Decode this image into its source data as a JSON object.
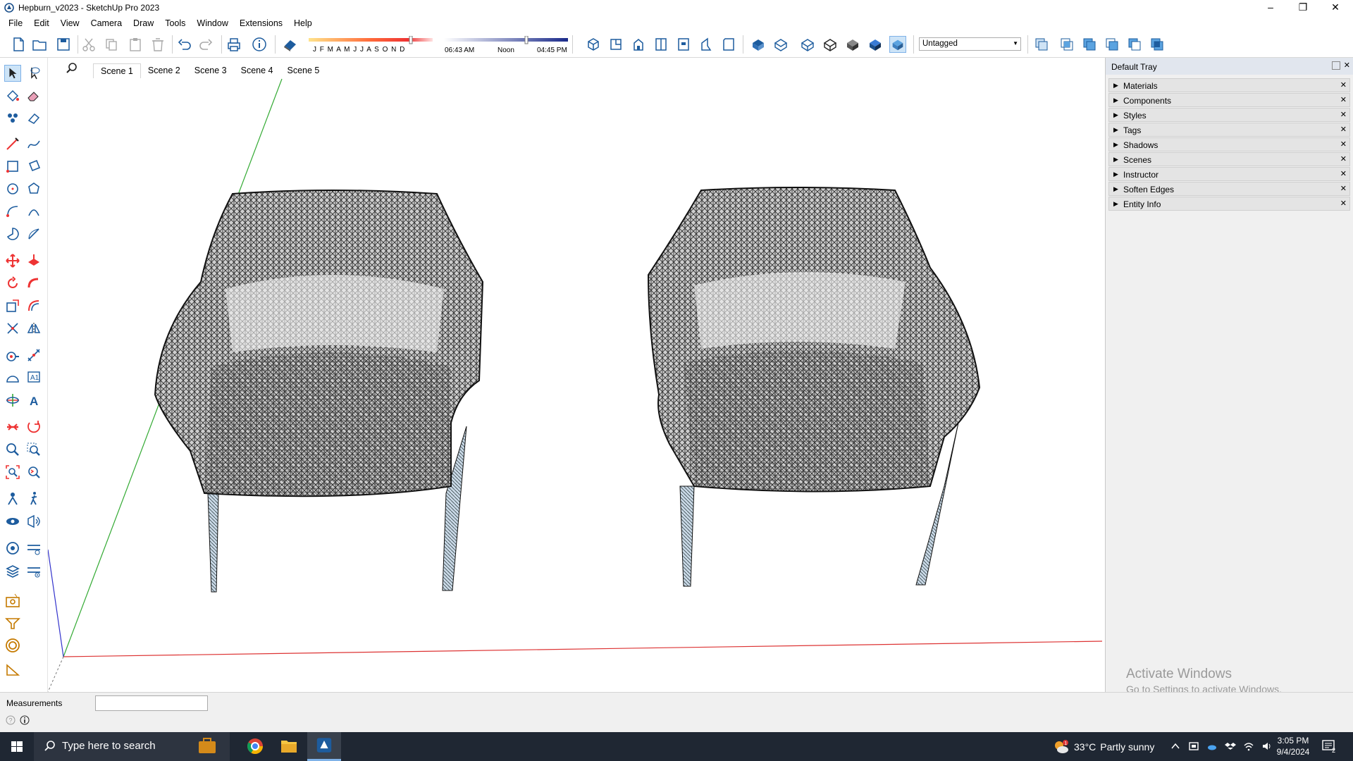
{
  "window": {
    "title": "Hepburn_v2023 - SketchUp Pro 2023",
    "minimize": "–",
    "restore": "❐",
    "close": "✕"
  },
  "menu": [
    "File",
    "Edit",
    "View",
    "Camera",
    "Draw",
    "Tools",
    "Window",
    "Extensions",
    "Help"
  ],
  "shadow": {
    "months": "J F M A M J J A S O N D",
    "time_start": "06:43 AM",
    "time_noon": "Noon",
    "time_end": "04:45 PM"
  },
  "tag_selector": {
    "value": "Untagged"
  },
  "scenes": [
    "Scene 1",
    "Scene 2",
    "Scene 3",
    "Scene 4",
    "Scene 5"
  ],
  "active_scene": "Scene 1",
  "tray": {
    "title": "Default Tray",
    "panels": [
      "Materials",
      "Components",
      "Styles",
      "Tags",
      "Shadows",
      "Scenes",
      "Instructor",
      "Soften Edges",
      "Entity Info"
    ]
  },
  "watermark": {
    "line1": "Activate Windows",
    "line2": "Go to Settings to activate Windows."
  },
  "status": {
    "measurements_label": "Measurements",
    "measurements_value": ""
  },
  "taskbar": {
    "search_placeholder": "Type here to search",
    "weather_temp": "33°C",
    "weather_desc": "Partly sunny",
    "weather_badge": "1",
    "time": "3:05 PM",
    "date": "9/4/2024",
    "notifications": "2"
  },
  "colors": {
    "axis_red": "#d33",
    "axis_green": "#3a3",
    "axis_blue": "#33c",
    "accent": "#0078d7"
  }
}
